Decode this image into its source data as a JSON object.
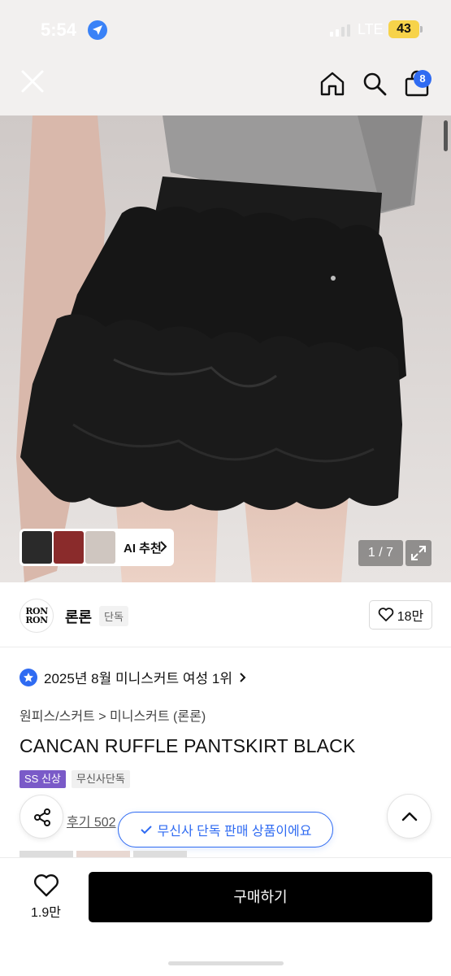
{
  "status_bar": {
    "time": "5:54",
    "network": "LTE",
    "battery": "43"
  },
  "header": {
    "icons": [
      "close-icon",
      "home-icon",
      "search-icon",
      "shopping-bag-icon"
    ],
    "cart_count": "8"
  },
  "gallery": {
    "ai_recommend_label": "AI 추천",
    "page_indicator": "1 / 7"
  },
  "brand": {
    "logo_line1": "RON",
    "logo_line2": "RON",
    "name": "론론",
    "tag": "단독",
    "likes": "18만"
  },
  "product": {
    "ranking": "2025년 8월 미니스커트 여성 1위",
    "breadcrumb": "원피스/스커트 > 미니스커트 (론론)",
    "title": "CANCAN RUFFLE PANTSKIRT BLACK",
    "badges": [
      "SS 신상",
      "무신사단독"
    ],
    "review_text": "후기 502",
    "toast": "무신사 단독 판매 상품이에요"
  },
  "bottom_bar": {
    "wish_count": "1.9만",
    "buy_label": "구매하기"
  },
  "colors": {
    "accent_blue": "#2f6bf2",
    "tag_purple": "#7a5ac8",
    "buy_button": "#000000"
  }
}
